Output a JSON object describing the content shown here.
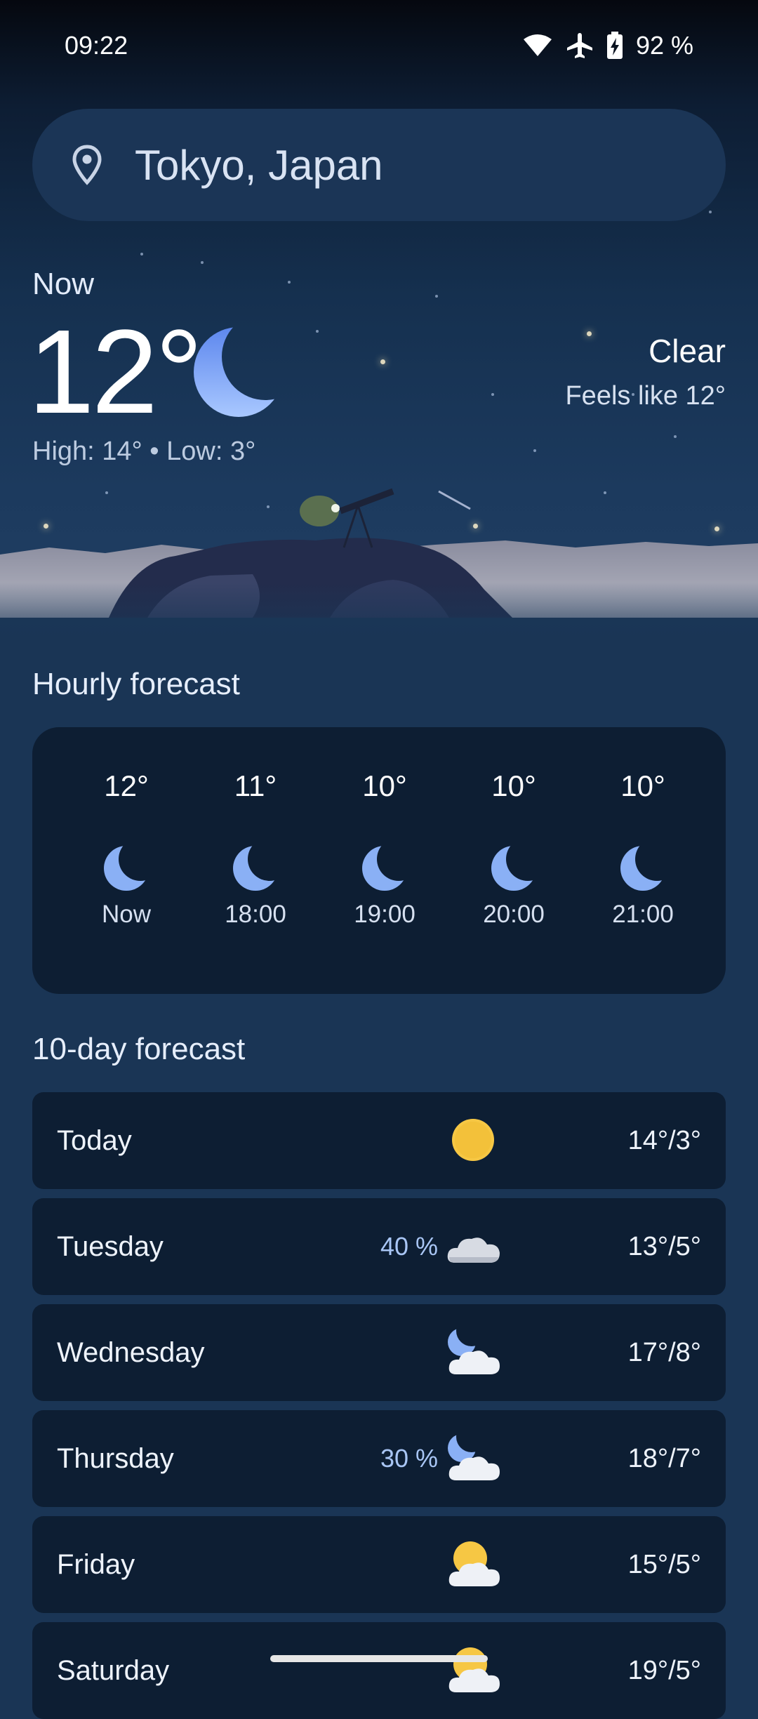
{
  "status_bar": {
    "time": "09:22",
    "battery": "92 %"
  },
  "search": {
    "location": "Tokyo, Japan"
  },
  "current": {
    "label": "Now",
    "temp": "12°",
    "high_low": "High: 14° • Low: 3°",
    "condition": "Clear",
    "feels_like": "Feels like 12°"
  },
  "hourly": {
    "title": "Hourly forecast",
    "items": [
      {
        "temp": "12°",
        "time": "Now",
        "icon": "moon-icon"
      },
      {
        "temp": "11°",
        "time": "18:00",
        "icon": "moon-icon"
      },
      {
        "temp": "10°",
        "time": "19:00",
        "icon": "moon-icon"
      },
      {
        "temp": "10°",
        "time": "20:00",
        "icon": "moon-icon"
      },
      {
        "temp": "10°",
        "time": "21:00",
        "icon": "moon-icon"
      }
    ]
  },
  "daily": {
    "title": "10-day forecast",
    "items": [
      {
        "day": "Today",
        "precip": "",
        "icon": "sun-icon",
        "temps": "14°/3°"
      },
      {
        "day": "Tuesday",
        "precip": "40 %",
        "icon": "cloud-icon",
        "temps": "13°/5°"
      },
      {
        "day": "Wednesday",
        "precip": "",
        "icon": "moon-cloud-icon",
        "temps": "17°/8°"
      },
      {
        "day": "Thursday",
        "precip": "30 %",
        "icon": "moon-cloud-icon",
        "temps": "18°/7°"
      },
      {
        "day": "Friday",
        "precip": "",
        "icon": "sun-cloud-icon",
        "temps": "15°/5°"
      },
      {
        "day": "Saturday",
        "precip": "",
        "icon": "sun-cloud-icon",
        "temps": "19°/5°"
      }
    ]
  },
  "colors": {
    "background": "#1a3555",
    "card": "#0d1e33",
    "moon": "#8ab0f5",
    "sun": "#f6c744",
    "precip": "#a9c6f5"
  }
}
